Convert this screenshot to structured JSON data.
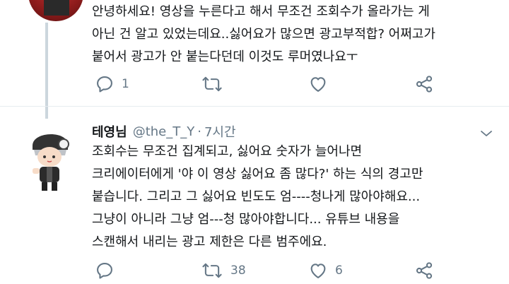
{
  "reply_tweet": {
    "lines": [
      "안녕하세요! 영상을 누른다고 해서 무조건 조회수가 올라가는 게",
      "아닌 건 알고 있었는데요..싫어요가 많으면 광고부적합? 어쩌고가",
      "붙어서 광고가 안 붙는다던데 이것도 루머였나요ㅜ"
    ],
    "actions": {
      "reply_count": "1",
      "retweet_count": "",
      "like_count": ""
    }
  },
  "answer_tweet": {
    "name": "테영님",
    "handle": "@the_T_Y",
    "separator": "·",
    "time": "7시간",
    "lines": [
      "조회수는 무조건 집계되고, 싫어요 숫자가 늘어나면",
      "크리에이터에게 '야 이 영상 싫어요 좀 많다?' 하는 식의 경고만",
      "붙습니다. 그리고 그 싫어요 빈도도 엄----청나게 많아야해요...",
      "그냥이 아니라 그냥 엄---청 많아야합니다... 유튜브 내용을",
      "스캔해서 내리는 광고 제한은 다른 범주에요."
    ],
    "actions": {
      "reply_count": "",
      "retweet_count": "38",
      "like_count": "6"
    }
  },
  "colors": {
    "icon_gray": "#657786",
    "text": "#14171a",
    "thread_line": "#ccd6dd"
  },
  "icons": [
    "reply-icon",
    "retweet-icon",
    "like-icon",
    "share-icon",
    "chevron-down-icon"
  ]
}
